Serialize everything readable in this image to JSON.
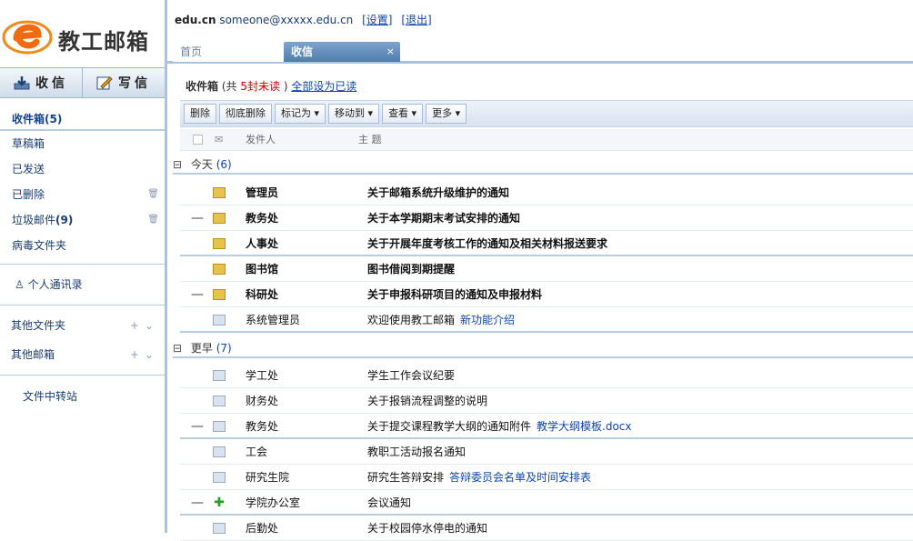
{
  "app": {
    "logo_text": "教工邮箱"
  },
  "sidebar": {
    "receive_label": "收信",
    "compose_label": "写信",
    "folders": [
      {
        "label": "收件箱",
        "count": "(5)",
        "active": true
      },
      {
        "label": "草稿箱",
        "count": ""
      },
      {
        "label": "已发送",
        "count": ""
      },
      {
        "label": "已删除",
        "count": ""
      },
      {
        "label": "垃圾邮件",
        "count": "(9)"
      },
      {
        "label": "病毒文件夹",
        "count": ""
      }
    ],
    "contacts_label": "个人通讯录",
    "other_folders_label": "其他文件夹",
    "other_mailboxes_label": "其他邮箱",
    "transfer_label": "文件中转站"
  },
  "header": {
    "account_label": "edu.cn",
    "email": "someone@xxxxx.edu.cn",
    "links": [
      "[设置]",
      "[退出]"
    ]
  },
  "tabs": {
    "home_label": "首页",
    "inbox_label": "收信",
    "close_glyph": "×"
  },
  "summary": {
    "label": "收件箱",
    "text_1": "(共",
    "unread": "5封未读",
    "text_2": ")",
    "link": "全部设为已读"
  },
  "toolbar": {
    "buttons": [
      "删除",
      "彻底删除",
      "标记为 ▾",
      "移动到 ▾",
      "查看 ▾",
      "更多 ▾"
    ]
  },
  "columns": {
    "sender": "发件人",
    "subject": "主 题"
  },
  "groups": [
    {
      "toggle": "⊟",
      "label": "今天",
      "count": "(6)"
    },
    {
      "toggle": "⊟",
      "label": "更早",
      "count": "(7)"
    }
  ],
  "messages_today": [
    {
      "from": "管理员",
      "subject": "关于邮箱系统升级维护的通知",
      "unread": true,
      "dash": false
    },
    {
      "from": "教务处",
      "subject": "关于本学期期末考试安排的通知",
      "unread": true,
      "dash": true
    },
    {
      "from": "人事处",
      "subject": "关于开展年度考核工作的通知及相关材料报送要求",
      "unread": true,
      "dash": false
    },
    {
      "from": "图书馆",
      "subject": "图书借阅到期提醒",
      "unread": true,
      "dash": false
    },
    {
      "from": "科研处",
      "subject": "关于申报科研项目的通知及申报材料",
      "unread": true,
      "dash": true
    },
    {
      "from": "系统管理员",
      "subject": "欢迎使用教工邮箱",
      "subject_tail": "新功能介绍",
      "unread": false,
      "dash": false
    }
  ],
  "messages_earlier": [
    {
      "from": "学工处",
      "subject": "学生工作会议纪要",
      "unread": false,
      "dash": false,
      "icon": "read"
    },
    {
      "from": "财务处",
      "subject": "关于报销流程调整的说明",
      "unread": false,
      "dash": false,
      "icon": "read"
    },
    {
      "from": "教务处",
      "subject": "关于提交课程教学大纲的通知附件",
      "subject_tail": "教学大纲模板.docx",
      "unread": false,
      "dash": true,
      "icon": "read"
    },
    {
      "from": "工会",
      "subject": "教职工活动报名通知",
      "unread": false,
      "dash": false,
      "icon": "read"
    },
    {
      "from": "研究生院",
      "subject": "研究生答辩安排",
      "subject_tail": "答辩委员会名单及时间安排表",
      "unread": false,
      "dash": false,
      "icon": "read"
    },
    {
      "from": "学院办公室",
      "subject": "会议通知",
      "unread": false,
      "dash": true,
      "icon": "green"
    },
    {
      "from": "后勤处",
      "subject": "关于校园停水停电的通知",
      "unread": false,
      "dash": false,
      "icon": "read"
    }
  ]
}
